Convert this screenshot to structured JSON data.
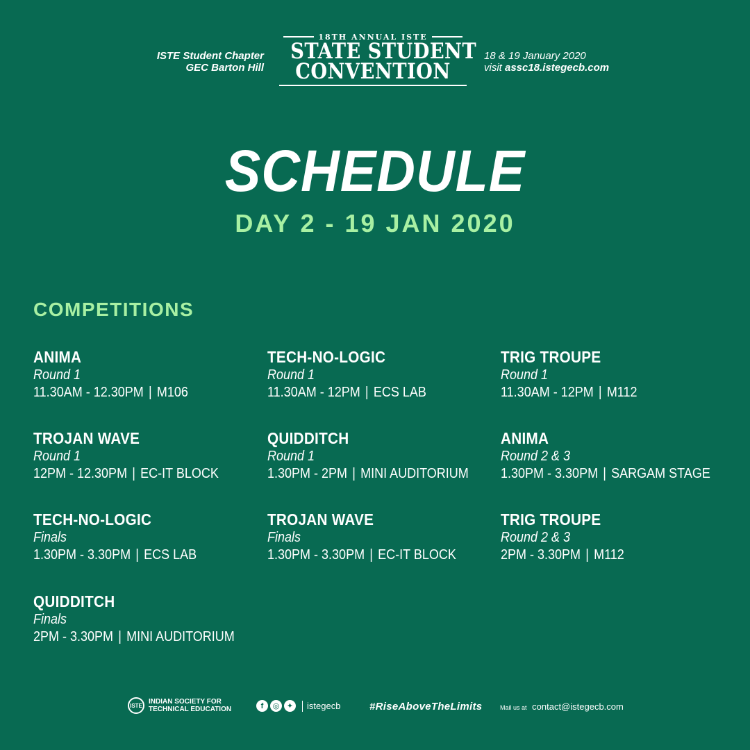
{
  "header": {
    "left_line1": "ISTE Student Chapter",
    "left_line2": "GEC Barton Hill",
    "logo_top": "18TH ANNUAL ISTE",
    "logo_line1": "STATE STUDENT",
    "logo_line2": "CONVENTION",
    "right_line1": "18 & 19 January 2020",
    "right_visit": "visit ",
    "right_url": "assc18.istegecb.com"
  },
  "title": "SCHEDULE",
  "subtitle": "DAY 2 - 19 JAN 2020",
  "section": "COMPETITIONS",
  "events": [
    {
      "name": "ANIMA",
      "round": "Round 1",
      "time": "11.30AM - 12.30PM",
      "venue": "M106"
    },
    {
      "name": "TECH-NO-LOGIC",
      "round": "Round 1",
      "time": "11.30AM - 12PM",
      "venue": "ECS LAB"
    },
    {
      "name": "TRIG TROUPE",
      "round": "Round 1",
      "time": "11.30AM - 12PM",
      "venue": "M112"
    },
    {
      "name": "TROJAN WAVE",
      "round": "Round 1",
      "time": "12PM - 12.30PM",
      "venue": "EC-IT BLOCK"
    },
    {
      "name": "QUIDDITCH",
      "round": "Round 1",
      "time": "1.30PM - 2PM",
      "venue": "MINI AUDITORIUM"
    },
    {
      "name": "ANIMA",
      "round": "Round 2 & 3",
      "time": "1.30PM - 3.30PM",
      "venue": "SARGAM STAGE"
    },
    {
      "name": "TECH-NO-LOGIC",
      "round": "Finals",
      "time": "1.30PM - 3.30PM",
      "venue": "ECS LAB"
    },
    {
      "name": "TROJAN WAVE",
      "round": "Finals",
      "time": "1.30PM - 3.30PM",
      "venue": "EC-IT BLOCK"
    },
    {
      "name": "TRIG TROUPE",
      "round": "Round 2 & 3",
      "time": "2PM - 3.30PM",
      "venue": "M112"
    },
    {
      "name": "QUIDDITCH",
      "round": "Finals",
      "time": "2PM - 3.30PM",
      "venue": "MINI AUDITORIUM"
    }
  ],
  "separator": "|",
  "footer": {
    "org_line1": "INDIAN SOCIETY FOR",
    "org_line2": "TECHNICAL EDUCATION",
    "org_logo_text": "ISTE",
    "social_icons": [
      "facebook-icon",
      "instagram-icon",
      "twitter-icon"
    ],
    "handle": "istegecb",
    "hashtag": "#RiseAboveTheLimits",
    "mail_label": "Mail us at",
    "mail": "contact@istegecb.com"
  }
}
